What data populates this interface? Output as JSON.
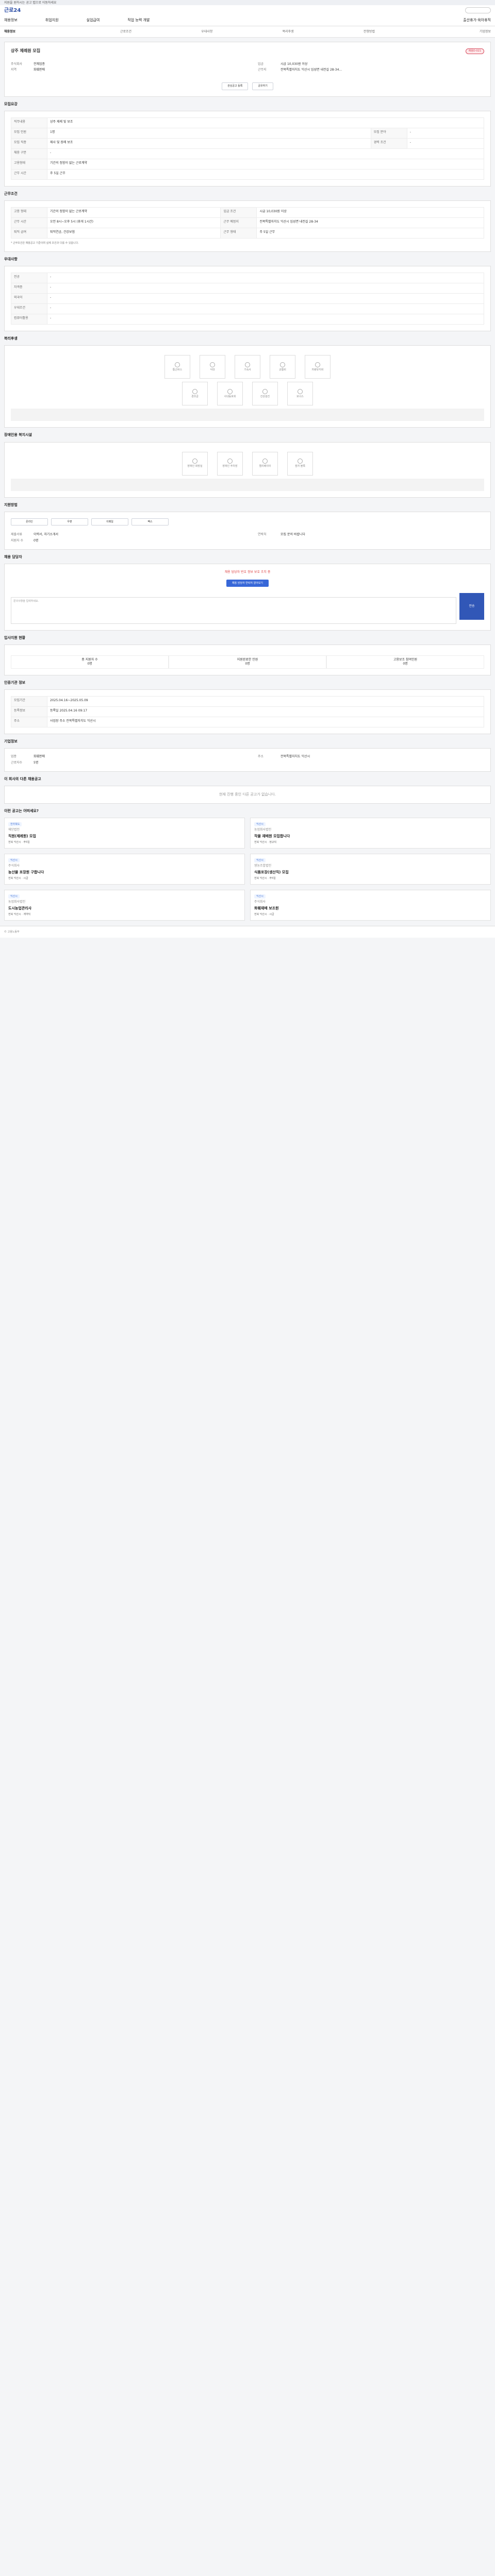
{
  "topbar": "지원을 원하시는 공고 탭으로 이동하세요",
  "site_title": "근로24",
  "nav": [
    "채용정보",
    "취업지원",
    "실업급여",
    "직업 능력 개발",
    "출산휴가·육아휴직"
  ],
  "tabs": [
    "채용정보",
    "근로조건",
    "우대사항",
    "복리후생",
    "전형방법",
    "기업정보"
  ],
  "job": {
    "title": "상주 제례원 모집",
    "badge": "채용D-021",
    "labels": {
      "company": "주식회사",
      "location": "지역",
      "salary": "임금",
      "region": "근무지"
    },
    "left": [
      "전체업종",
      "화훼판매"
    ],
    "right": [
      "시급 10,030원 이상",
      "전북특별자치도 익산시 임성면 내전길 28-34..."
    ]
  },
  "section_label": "모집요강",
  "recruit": [
    [
      "직무내용",
      "상주 제례 및 보조"
    ],
    [
      "모집 인원",
      "1명"
    ],
    [
      "모집 직종",
      "제사 및 장례 보조"
    ],
    [
      "채용 구분",
      "-"
    ],
    [
      "고용형태",
      "기간의 정함이 없는 근로계약"
    ],
    [
      "근무 시간",
      "주 5일 근무"
    ]
  ],
  "work_conditions": [
    [
      "고용 형태",
      "기간의 정함이 없는 근로계약",
      "임금 조건",
      "시급 10,030원 이상"
    ],
    [
      "근무 시간",
      "오전 8시~오후 5시 (휴게 1시간)",
      "근무 예정지",
      "전북특별자치도 익산시 임성면 내전길 28-34"
    ],
    [
      "퇴직 급여",
      "퇴직연금, 건강보험",
      "근무 형태",
      "주 5일 근무"
    ]
  ],
  "preferences": [
    "전공",
    "자격증",
    "외국어",
    "우대조건",
    "컴퓨터활용"
  ],
  "benefits": [
    "통근버스",
    "식대",
    "기숙사",
    "교통비",
    "차량유지비",
    "경조금",
    "사내동호회",
    "건강검진",
    "보너스"
  ],
  "disabled_facilities": [
    "장애인 화장실",
    "장애인 주차장",
    "엘리베이터",
    "점자 블록"
  ],
  "apply": {
    "methods": [
      "온라인",
      "우편",
      "이메일",
      "팩스"
    ],
    "doc": "이력서, 자기소개서",
    "count": "0명",
    "contact": "모집 문의 바랍니다"
  },
  "apply_notice": "채용 담당자 번호 정보 보호 조치 중",
  "apply_cta": "채용 담당자 연락처 알아보기",
  "status": [
    "총 지원자 수",
    "지원완료한 인원",
    "고용보조 참여인원"
  ],
  "status_vals": [
    "0명",
    "0명",
    "0명"
  ],
  "entry": {
    "title": "인증기관 정보",
    "period": "2025.04.16~2025.05.09",
    "rows": [
      "등록일 2025.04.16 09:17",
      "사업장 주소 전북특별자치도 익산시"
    ]
  },
  "company_info": {
    "name": "기업정보",
    "biz": "화훼판매",
    "employees": "5명",
    "address": "전북특별자치도 익산시"
  },
  "recs": [
    {
      "tag": "전라북도",
      "company": "재단법인",
      "title": "직원(제례원) 모집",
      "meta": "전북 익산시 · 주5일"
    },
    {
      "tag": "익산시",
      "company": "농업회사법인",
      "title": "작물 재배원 모집합니다",
      "meta": "전북 익산시 · 정규직"
    },
    {
      "tag": "익산시",
      "company": "주식회사",
      "title": "농산물 포장원 구합니다",
      "meta": "전북 익산시 · 시급"
    },
    {
      "tag": "익산시",
      "company": "영농조합법인",
      "title": "식품포장(생산직) 모집",
      "meta": "전북 익산시 · 주5일"
    },
    {
      "tag": "익산시",
      "company": "농업회사법인",
      "title": "도시농업관리사",
      "meta": "전북 익산시 · 계약직"
    },
    {
      "tag": "익산시",
      "company": "주식회사",
      "title": "화훼재배 보조원",
      "meta": "전북 익산시 · 시급"
    }
  ]
}
